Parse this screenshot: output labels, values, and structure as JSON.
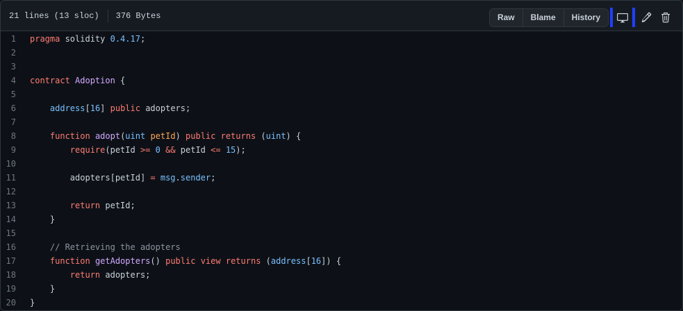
{
  "file_info": {
    "lines": "21 lines (13 sloc)",
    "size": "376 Bytes"
  },
  "toolbar": {
    "raw_label": "Raw",
    "blame_label": "Blame",
    "history_label": "History",
    "icons": [
      "desktop-icon",
      "pencil-icon",
      "trash-icon"
    ]
  },
  "colors": {
    "background": "#0d1117",
    "keyword": "#ff7b72",
    "function": "#d2a8ff",
    "type": "#79c0ff",
    "parameter": "#ffa657",
    "comment": "#8b949e",
    "line_number": "#6e7681"
  },
  "code_lines": [
    {
      "num": "1",
      "tokens": [
        {
          "t": "pragma",
          "c": "kw"
        },
        {
          "t": " solidity ",
          "c": "pl"
        },
        {
          "t": "0.4.17",
          "c": "num"
        },
        {
          "t": ";",
          "c": "pl"
        }
      ]
    },
    {
      "num": "2",
      "tokens": []
    },
    {
      "num": "3",
      "tokens": []
    },
    {
      "num": "4",
      "tokens": [
        {
          "t": "contract",
          "c": "kw"
        },
        {
          "t": " ",
          "c": "pl"
        },
        {
          "t": "Adoption",
          "c": "fn"
        },
        {
          "t": " {",
          "c": "pl"
        }
      ]
    },
    {
      "num": "5",
      "tokens": []
    },
    {
      "num": "6",
      "tokens": [
        {
          "t": "    ",
          "c": "pl"
        },
        {
          "t": "address",
          "c": "ty"
        },
        {
          "t": "[",
          "c": "pl"
        },
        {
          "t": "16",
          "c": "num"
        },
        {
          "t": "] ",
          "c": "pl"
        },
        {
          "t": "public",
          "c": "kw"
        },
        {
          "t": " adopters;",
          "c": "pl"
        }
      ]
    },
    {
      "num": "7",
      "tokens": []
    },
    {
      "num": "8",
      "tokens": [
        {
          "t": "    ",
          "c": "pl"
        },
        {
          "t": "function",
          "c": "kw"
        },
        {
          "t": " ",
          "c": "pl"
        },
        {
          "t": "adopt",
          "c": "fn"
        },
        {
          "t": "(",
          "c": "pl"
        },
        {
          "t": "uint",
          "c": "ty"
        },
        {
          "t": " ",
          "c": "pl"
        },
        {
          "t": "petId",
          "c": "param"
        },
        {
          "t": ") ",
          "c": "pl"
        },
        {
          "t": "public",
          "c": "kw"
        },
        {
          "t": " ",
          "c": "pl"
        },
        {
          "t": "returns",
          "c": "kw"
        },
        {
          "t": " (",
          "c": "pl"
        },
        {
          "t": "uint",
          "c": "ty"
        },
        {
          "t": ") {",
          "c": "pl"
        }
      ]
    },
    {
      "num": "9",
      "tokens": [
        {
          "t": "        ",
          "c": "pl"
        },
        {
          "t": "require",
          "c": "kw"
        },
        {
          "t": "(petId ",
          "c": "pl"
        },
        {
          "t": ">=",
          "c": "op"
        },
        {
          "t": " ",
          "c": "pl"
        },
        {
          "t": "0",
          "c": "num"
        },
        {
          "t": " ",
          "c": "pl"
        },
        {
          "t": "&&",
          "c": "op"
        },
        {
          "t": " petId ",
          "c": "pl"
        },
        {
          "t": "<=",
          "c": "op"
        },
        {
          "t": " ",
          "c": "pl"
        },
        {
          "t": "15",
          "c": "num"
        },
        {
          "t": ");",
          "c": "pl"
        }
      ]
    },
    {
      "num": "10",
      "tokens": []
    },
    {
      "num": "11",
      "tokens": [
        {
          "t": "        adopters[petId] ",
          "c": "pl"
        },
        {
          "t": "=",
          "c": "op"
        },
        {
          "t": " ",
          "c": "pl"
        },
        {
          "t": "msg",
          "c": "ty"
        },
        {
          "t": ".",
          "c": "pl"
        },
        {
          "t": "sender",
          "c": "ty"
        },
        {
          "t": ";",
          "c": "pl"
        }
      ]
    },
    {
      "num": "12",
      "tokens": []
    },
    {
      "num": "13",
      "tokens": [
        {
          "t": "        ",
          "c": "pl"
        },
        {
          "t": "return",
          "c": "kw"
        },
        {
          "t": " petId;",
          "c": "pl"
        }
      ]
    },
    {
      "num": "14",
      "tokens": [
        {
          "t": "    }",
          "c": "pl"
        }
      ]
    },
    {
      "num": "15",
      "tokens": []
    },
    {
      "num": "16",
      "tokens": [
        {
          "t": "    ",
          "c": "pl"
        },
        {
          "t": "// Retrieving the adopters",
          "c": "cm"
        }
      ]
    },
    {
      "num": "17",
      "tokens": [
        {
          "t": "    ",
          "c": "pl"
        },
        {
          "t": "function",
          "c": "kw"
        },
        {
          "t": " ",
          "c": "pl"
        },
        {
          "t": "getAdopters",
          "c": "fn"
        },
        {
          "t": "() ",
          "c": "pl"
        },
        {
          "t": "public",
          "c": "kw"
        },
        {
          "t": " ",
          "c": "pl"
        },
        {
          "t": "view",
          "c": "kw"
        },
        {
          "t": " ",
          "c": "pl"
        },
        {
          "t": "returns",
          "c": "kw"
        },
        {
          "t": " (",
          "c": "pl"
        },
        {
          "t": "address",
          "c": "ty"
        },
        {
          "t": "[",
          "c": "pl"
        },
        {
          "t": "16",
          "c": "num"
        },
        {
          "t": "]) {",
          "c": "pl"
        }
      ]
    },
    {
      "num": "18",
      "tokens": [
        {
          "t": "        ",
          "c": "pl"
        },
        {
          "t": "return",
          "c": "kw"
        },
        {
          "t": " adopters;",
          "c": "pl"
        }
      ]
    },
    {
      "num": "19",
      "tokens": [
        {
          "t": "    }",
          "c": "pl"
        }
      ]
    },
    {
      "num": "20",
      "tokens": [
        {
          "t": "}",
          "c": "pl"
        }
      ]
    }
  ]
}
